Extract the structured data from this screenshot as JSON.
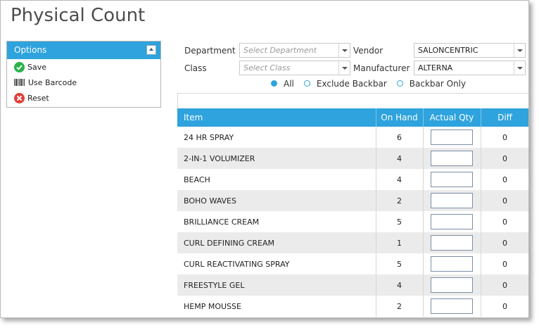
{
  "page": {
    "title": "Physical Count"
  },
  "options": {
    "header": "Options",
    "items": [
      {
        "label": "Save",
        "icon": "check-circle-icon"
      },
      {
        "label": "Use Barcode",
        "icon": "barcode-icon"
      },
      {
        "label": "Reset",
        "icon": "x-circle-icon"
      }
    ]
  },
  "filters": {
    "department": {
      "label": "Department",
      "placeholder": "Select Department"
    },
    "class": {
      "label": "Class",
      "placeholder": "Select Class"
    },
    "vendor": {
      "label": "Vendor",
      "value": "SALONCENTRIC"
    },
    "manufacturer": {
      "label": "Manufacturer",
      "value": "ALTERNA"
    },
    "radios": [
      {
        "label": "All",
        "selected": true
      },
      {
        "label": "Exclude Backbar",
        "selected": false
      },
      {
        "label": "Backbar Only",
        "selected": false
      }
    ]
  },
  "grid": {
    "columns": [
      "Item",
      "On Hand",
      "Actual Qty",
      "Diff"
    ],
    "rows": [
      {
        "item": "24 HR SPRAY",
        "on_hand": "6",
        "actual_qty": "",
        "diff": "0"
      },
      {
        "item": "2-IN-1 VOLUMIZER",
        "on_hand": "4",
        "actual_qty": "",
        "diff": "0"
      },
      {
        "item": "BEACH",
        "on_hand": "4",
        "actual_qty": "",
        "diff": "0"
      },
      {
        "item": "BOHO WAVES",
        "on_hand": "2",
        "actual_qty": "",
        "diff": "0"
      },
      {
        "item": "BRILLIANCE CREAM",
        "on_hand": "5",
        "actual_qty": "",
        "diff": "0"
      },
      {
        "item": "CURL DEFINING CREAM",
        "on_hand": "1",
        "actual_qty": "",
        "diff": "0"
      },
      {
        "item": "CURL REACTIVATING SPRAY",
        "on_hand": "5",
        "actual_qty": "",
        "diff": "0"
      },
      {
        "item": "FREESTYLE GEL",
        "on_hand": "4",
        "actual_qty": "",
        "diff": "0"
      },
      {
        "item": "HEMP MOUSSE",
        "on_hand": "2",
        "actual_qty": "",
        "diff": "0"
      }
    ]
  },
  "colors": {
    "accent": "#2ea3dd",
    "row_alt": "#ebebeb",
    "save": "#2bb34a",
    "reset": "#e0403a"
  }
}
